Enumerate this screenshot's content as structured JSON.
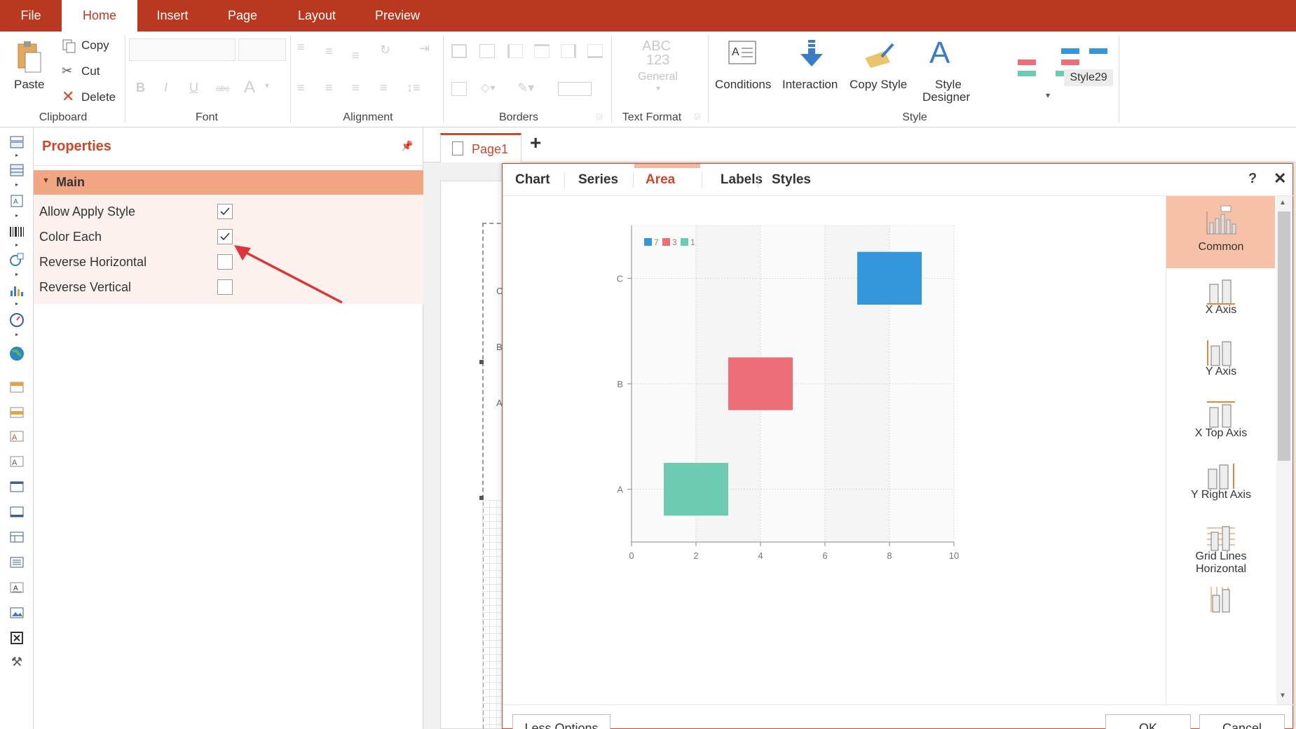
{
  "menu": {
    "tabs": [
      "File",
      "Home",
      "Insert",
      "Page",
      "Layout",
      "Preview"
    ],
    "active": "Home"
  },
  "ribbon": {
    "clipboard": {
      "paste": "Paste",
      "copy": "Copy",
      "cut": "Cut",
      "delete": "Delete",
      "label": "Clipboard"
    },
    "font": {
      "label": "Font"
    },
    "alignment": {
      "label": "Alignment"
    },
    "borders": {
      "label": "Borders"
    },
    "text_format": {
      "label": "Text Format",
      "abc": "ABC",
      "num": "123",
      "general": "General"
    },
    "style": {
      "conditions": "Conditions",
      "interaction": "Interaction",
      "copy_style": "Copy Style",
      "style_designer_1": "Style",
      "style_designer_2": "Designer",
      "style_name": "Style29",
      "label": "Style"
    }
  },
  "properties": {
    "title": "Properties",
    "section": "Main",
    "rows": [
      {
        "label": "Allow Apply Style",
        "checked": true
      },
      {
        "label": "Color Each",
        "checked": true
      },
      {
        "label": "Reverse Horizontal",
        "checked": false
      },
      {
        "label": "Reverse Vertical",
        "checked": false
      }
    ]
  },
  "pagetab": {
    "label": "Page1",
    "add": "+"
  },
  "page_letters": [
    "C",
    "B",
    "A"
  ],
  "dialog": {
    "tabs": [
      "Chart",
      "Series",
      "Area",
      "Labels",
      "Styles"
    ],
    "active_tab": "Area",
    "help": "?",
    "close": "✕",
    "side": [
      "Common",
      "X Axis",
      "Y Axis",
      "X Top Axis",
      "Y Right Axis",
      "Grid Lines",
      "Horizontal"
    ],
    "less_options": "Less Options",
    "ok": "OK",
    "cancel": "Cancel"
  },
  "chart_data": {
    "type": "gantt",
    "categories": [
      "A",
      "B",
      "C"
    ],
    "x_ticks": [
      "0",
      "2",
      "4",
      "6",
      "8",
      "10"
    ],
    "xlim": [
      0,
      10
    ],
    "legend": [
      "7",
      "3",
      "1"
    ],
    "legend_position": "top-left",
    "grid": true,
    "series": [
      {
        "name": "1",
        "category": "A",
        "start": 1,
        "end": 3,
        "color": "#6ccbb0"
      },
      {
        "name": "3",
        "category": "B",
        "start": 3,
        "end": 5,
        "color": "#ee6e78"
      },
      {
        "name": "7",
        "category": "C",
        "start": 7,
        "end": 9,
        "color": "#3497db"
      }
    ]
  }
}
